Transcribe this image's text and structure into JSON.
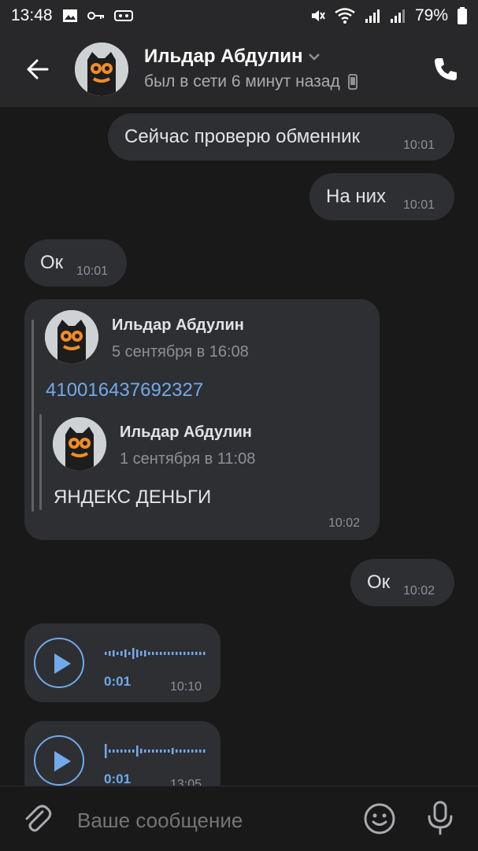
{
  "status_bar": {
    "time": "13:48",
    "battery": "79%"
  },
  "header": {
    "name": "Ильдар Абдулин",
    "status": "был в сети 6 минут назад"
  },
  "messages": [
    {
      "text": "Сейчас проверю обменник",
      "time": "10:01"
    },
    {
      "text": "На них",
      "time": "10:01"
    },
    {
      "text": "Ок",
      "time": "10:01"
    },
    {
      "forward": {
        "author": "Ильдар Абдулин",
        "date": "5 сентября в 16:08",
        "text": "410016437692327",
        "nested": {
          "author": "Ильдар Абдулин",
          "date": "1 сентября в 11:08",
          "text": "ЯНДЕКС ДЕНЬГИ"
        }
      },
      "time": "10:02"
    },
    {
      "text": "Ок",
      "time": "10:02"
    },
    {
      "voice": {
        "duration": "0:01"
      },
      "time": "10:10"
    },
    {
      "voice": {
        "duration": "0:01"
      },
      "time": "13:05"
    }
  ],
  "composer": {
    "placeholder": "Ваше сообщение"
  },
  "colors": {
    "accent": "#71aaeb",
    "bubble": "#2e2f33",
    "background": "#19191a",
    "header": "#28282a"
  }
}
